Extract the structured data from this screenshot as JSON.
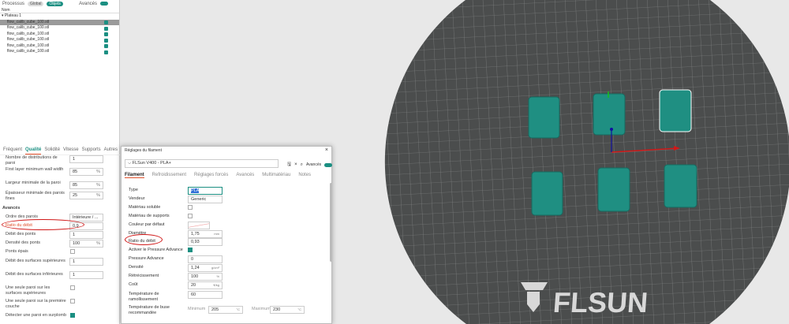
{
  "left": {
    "toolbar": {
      "process_label": "Processus",
      "global_label": "Global",
      "objects_label": "Objets",
      "advanced_label": "Avancés"
    },
    "objects": {
      "header": "Nom",
      "plate": "Plateau 1",
      "items": [
        "flow_calib_cube_100.stl",
        "flow_calib_cube_100.stl",
        "flow_calib_cube_100.stl",
        "flow_calib_cube_100.stl",
        "flow_calib_cube_100.stl",
        "flow_calib_cube_100.stl"
      ]
    },
    "tabs": [
      "Fréquent",
      "Qualité",
      "Solidité",
      "Vitesse",
      "Supports",
      "Autres"
    ],
    "params": [
      {
        "label": "Nombre de distributions de paroi",
        "value": "1"
      },
      {
        "label": "First layer minimum wall width",
        "value": "85",
        "unit": "%"
      },
      {
        "label": "Largeur minimale de la paroi",
        "value": "85",
        "unit": "%"
      },
      {
        "label": "Épaisseur minimale des parois fines",
        "value": "25",
        "unit": "%"
      }
    ],
    "advanced_heading": "Avancés",
    "adv": [
      {
        "label": "Ordre des parois",
        "value": "Intérieure / ..."
      },
      {
        "label": "Ratio du débit",
        "value": "0,9"
      },
      {
        "label": "Débit des ponts",
        "value": "1"
      },
      {
        "label": "Densité des ponts",
        "value": "100",
        "unit": "%"
      },
      {
        "label": "Ponts épais"
      },
      {
        "label": "Débit des surfaces supérieures",
        "value": "1"
      },
      {
        "label": "Débit des surfaces inférieures",
        "value": "1"
      },
      {
        "label": "Une seule paroi sur les surfaces supérieures"
      },
      {
        "label": "Une seule paroi sur la première couche"
      },
      {
        "label": "Détecter une paroi en surplomb"
      }
    ]
  },
  "dialog": {
    "title": "Réglages du filament",
    "preset": "FLSun V400 - PLA+",
    "advanced_label": "Avancés",
    "tabs": [
      "Filament",
      "Refroidissement",
      "Réglages forcés",
      "Avancés",
      "Multimatériau",
      "Notes"
    ],
    "rows": [
      {
        "label": "Type",
        "value": "PLA"
      },
      {
        "label": "Vendeur",
        "value": "Generic"
      },
      {
        "label": "Matériau soluble"
      },
      {
        "label": "Matériau de supports"
      },
      {
        "label": "Couleur par défaut"
      },
      {
        "label": "Diamètre",
        "value": "1,75",
        "unit": "mm"
      },
      {
        "label": "Ratio du débit",
        "value": "0,93"
      },
      {
        "label": "Activer le Pressure Advance"
      },
      {
        "label": "Pressure Advance",
        "value": "0"
      },
      {
        "label": "Densité",
        "value": "1,24",
        "unit": "g/cm³"
      },
      {
        "label": "Rétrécissement",
        "value": "100",
        "unit": "%"
      },
      {
        "label": "Coût",
        "value": "20",
        "unit": "€/kg"
      },
      {
        "label": "Température de ramollissement",
        "value": "60"
      },
      {
        "label": "Température de buse recommandée",
        "min_label": "Minimum",
        "min": "205",
        "max_label": "Maximum",
        "max": "230",
        "unit": "°C"
      }
    ]
  },
  "viewport": {
    "logo_text": "FLSUN",
    "object_color": "#1f8f82",
    "bed_color": "#4b4d4d"
  }
}
